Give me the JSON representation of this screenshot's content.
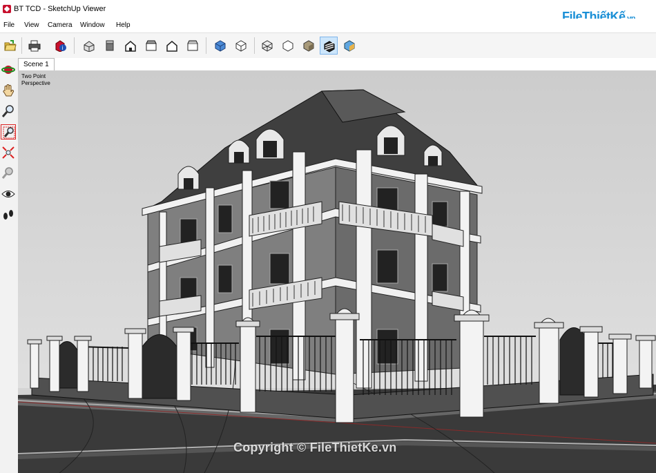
{
  "window": {
    "title": "BT TCD - SketchUp Viewer"
  },
  "brand": {
    "main": "FileThiếtKế",
    "suffix": ".vn"
  },
  "menu": [
    "File",
    "View",
    "Camera",
    "Window",
    "Help"
  ],
  "toolbar": {
    "active_tool": "style-shaded-textures"
  },
  "scene_tabs": [
    "Scene 1"
  ],
  "viewport": {
    "camera_line1": "Two Point",
    "camera_line2": "Perspective",
    "sky_color": "#d4d4d4",
    "ground_color": "#3a3a3a"
  },
  "watermark": "Copyright © FileThietKe.vn"
}
